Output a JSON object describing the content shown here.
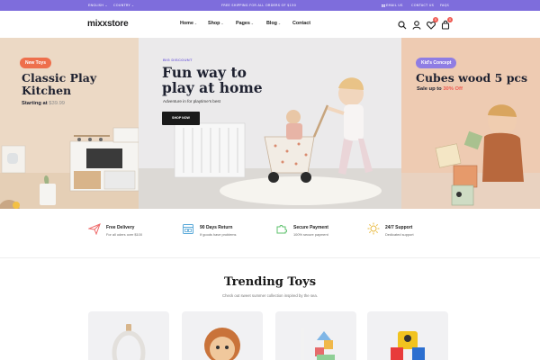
{
  "topbar": {
    "language": "ENGLISH ⌄",
    "country": "COUNTRY ⌄",
    "shipping": "FREE SHIPPING FOR ALL ORDERS OF $150",
    "email": "EMAIL US",
    "contact": "CONTACT US",
    "faqs": "FAQS"
  },
  "nav": {
    "logo": "mixxstore",
    "menu": [
      {
        "label": "Home",
        "has_dropdown": true
      },
      {
        "label": "Shop",
        "has_dropdown": true
      },
      {
        "label": "Pages",
        "has_dropdown": true
      },
      {
        "label": "Blog",
        "has_dropdown": true
      },
      {
        "label": "Contact",
        "has_dropdown": false
      }
    ],
    "icons": [
      "search-icon",
      "user-icon",
      "heart-icon",
      "cart-icon"
    ],
    "wishlist_count": "0",
    "cart_count": "0"
  },
  "hero": {
    "left": {
      "badge": "New Toys",
      "title": "Classic Play Kitchen",
      "price_prefix": "Starting at",
      "price": "$39.99"
    },
    "center": {
      "tag": "BIG DISCOUNT",
      "title": "Fun way to play at home",
      "subtitle": "Adventure in for playtime's best",
      "button": "SHOP NOW"
    },
    "right": {
      "badge": "Kid's Concept",
      "title": "Cubes wood 5 pcs",
      "sale_prefix": "Sale up to",
      "sale_value": "30% Off"
    }
  },
  "features": [
    {
      "icon": "paper-plane-icon",
      "title": "Free Delivery",
      "subtitle": "For all oders over $100"
    },
    {
      "icon": "calendar-icon",
      "title": "90 Days Return",
      "subtitle": "If goods have problems"
    },
    {
      "icon": "puzzle-icon",
      "title": "Secure Payment",
      "subtitle": "100% secure payment"
    },
    {
      "icon": "support-sun-icon",
      "title": "24/7 Support",
      "subtitle": "Dedicated support"
    }
  ],
  "trending": {
    "title": "Trending Toys",
    "subtitle": "Check out sweet summer collection inspired by the sea.",
    "products": [
      "wooden-ring-toy",
      "doll-head-toy",
      "walker-blocks-toy",
      "robot-toy"
    ]
  },
  "colors": {
    "accent": "#7e6ddc",
    "coral": "#ee6f4c",
    "badge_red": "#ef5a52"
  }
}
